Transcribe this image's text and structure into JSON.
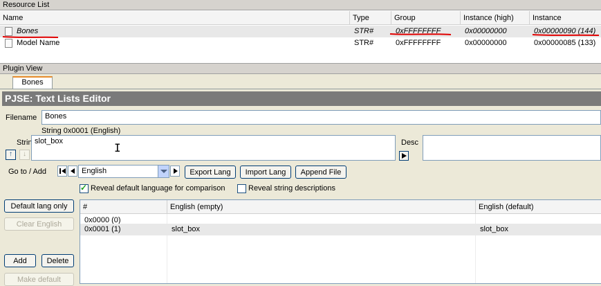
{
  "resource_list": {
    "title": "Resource List",
    "columns": [
      "Name",
      "Type",
      "Group",
      "Instance (high)",
      "Instance"
    ],
    "rows": [
      {
        "name": "Bones",
        "type": "STR#",
        "group": "0xFFFFFFFF",
        "inst_high": "0x00000000",
        "instance": "0x00000090 (144)"
      },
      {
        "name": "Model Name",
        "type": "STR#",
        "group": "0xFFFFFFFF",
        "inst_high": "0x00000000",
        "instance": "0x00000085 (133)"
      }
    ]
  },
  "plugin_view": {
    "title": "Plugin View",
    "tab": "Bones",
    "editor_title": "PJSE: Text Lists Editor"
  },
  "form": {
    "filename_label": "Filename",
    "filename_value": "Bones",
    "string_caption": "String 0x0001 (English)",
    "string_label": "String",
    "string_value": "slot_box",
    "desc_label": "Desc",
    "goto_label": "Go to / Add",
    "language_selected": "English",
    "export_lang": "Export Lang",
    "import_lang": "Import Lang",
    "append_file": "Append File",
    "reveal_default": "Reveal default language for comparison",
    "reveal_desc": "Reveal string descriptions"
  },
  "side_buttons": {
    "default_lang_only": "Default lang only",
    "clear_english": "Clear English",
    "add": "Add",
    "delete": "Delete",
    "make_default": "Make default"
  },
  "strings_table": {
    "columns": [
      "#",
      "English (empty)",
      "English (default)"
    ],
    "rows": [
      {
        "num": "0x0000 (0)",
        "english": "",
        "default": ""
      },
      {
        "num": "0x0001 (1)",
        "english": "slot_box",
        "default": "slot_box"
      }
    ]
  },
  "colors": {
    "editor_title_bar": "#7a7a7a",
    "selection_row": "#e8e8e8",
    "annotation_red": "#e00000"
  }
}
